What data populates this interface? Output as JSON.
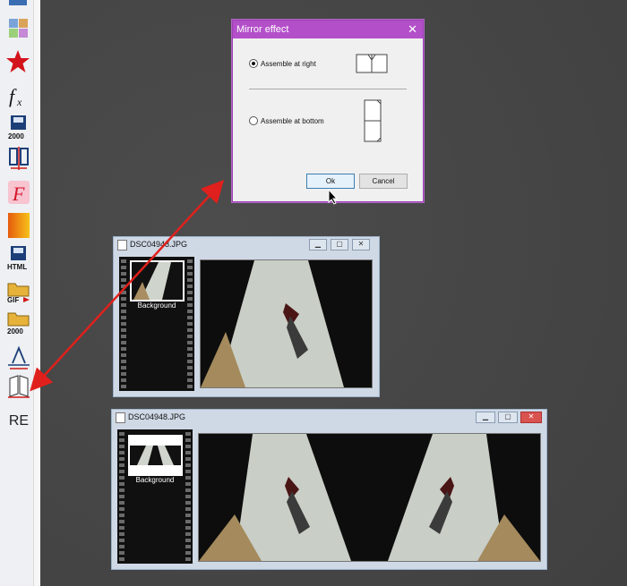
{
  "dialog": {
    "title": "Mirror effect",
    "close_glyph": "✕",
    "option_right": "Assemble at right",
    "option_bottom": "Assemble at bottom",
    "ok_label": "Ok",
    "cancel_label": "Cancel",
    "selected": "right"
  },
  "window_small": {
    "title": "DSC04948.JPG",
    "layer_label": "Background"
  },
  "window_large": {
    "title": "DSC04948.JPG",
    "layer_label": "Background"
  },
  "toolbar": {
    "re_label": "RE",
    "icons": [
      "grid-icon",
      "star-icon",
      "function-icon",
      "save-2000-icon",
      "mirror-icon",
      "font-icon",
      "gradient-icon",
      "save-html-icon",
      "open-gif-icon",
      "open-2000-icon",
      "perspective-icon",
      "mirror-effect-icon"
    ],
    "save_2000_label": "2000",
    "save_html_label": "HTML",
    "gif_label": "GIF",
    "open_2000_label": "2000"
  },
  "colors": {
    "dialog_title": "#b34fc9",
    "arrow": "#e0201c",
    "desktop": "#474747"
  }
}
